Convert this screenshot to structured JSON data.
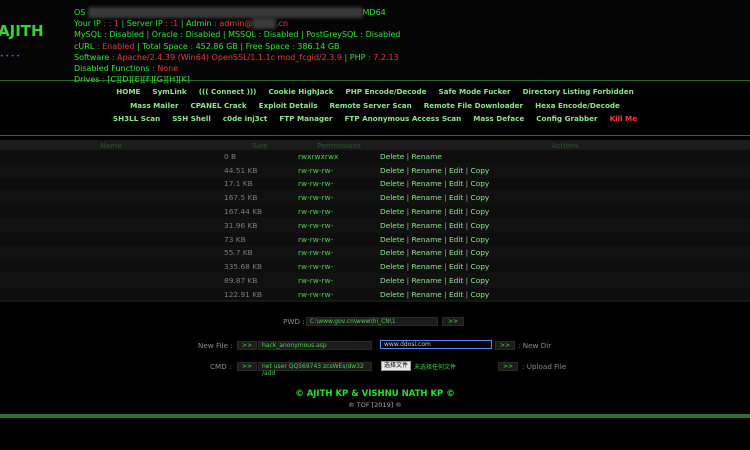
{
  "logo": {
    "text": "AJITH",
    "sub": "• • • •"
  },
  "info": {
    "os_label": "OS",
    "os_tail": "MD64",
    "user_label": "Your IP",
    "user_val": ": : 1",
    "server_label": "Server IP",
    "server_val": ": :1",
    "admin_label": "Admin",
    "admin_val": "admin@",
    "admin_tail": ".cn",
    "mysql_line": "MySQL : Disabled | Oracle : Disabled | MSSQL : Disabled | PostGreySQL : Disabled",
    "curl_label": "cURL",
    "curl_val": "Enabled",
    "total_label": "Total Space",
    "total_val": "452.86 GB",
    "free_label": "Free Space",
    "free_val": "386.14 GB",
    "software_label": "Software",
    "software_val": "Apache/2.4.39 (Win64) OpenSSL/1.1.1c mod_fcgid/2.3.9",
    "php_label": "PHP",
    "php_val": "7.2.13",
    "disabled_label": "Disabled Functions",
    "disabled_val": "None",
    "drives_label": "Drives",
    "drives_val": "[C][D][E][F][G][H][K]"
  },
  "nav": [
    [
      "HOME",
      "SymLink",
      "((( Connect )))",
      "Cookie HighJack",
      "PHP Encode/Decode",
      "Safe Mode Fucker",
      "Directory Listing Forbidden"
    ],
    [
      "Mass Mailer",
      "CPANEL Crack",
      "Exploit Details",
      "Remote Server Scan",
      "Remote File Downloader",
      "Hexa Encode/Decode"
    ],
    [
      "SH3LL Scan",
      "SSH Shell",
      "c0de inj3ct",
      "FTP Manager",
      "FTP Anonymous Access Scan",
      "Mass Deface",
      "Config Grabber",
      "Kill Me"
    ]
  ],
  "table": {
    "headers": {
      "name": "Name",
      "size": "Size",
      "perm": "Permissions",
      "actions": "Actions"
    },
    "rows": [
      {
        "size": "0 B",
        "perm": "rwxrwxrwx",
        "type": "dir"
      },
      {
        "size": "44.51 KB",
        "perm": "rw-rw-rw-",
        "type": "file"
      },
      {
        "size": "17.1 KB",
        "perm": "rw-rw-rw-",
        "type": "file"
      },
      {
        "size": "167.5 KB",
        "perm": "rw-rw-rw-",
        "type": "file"
      },
      {
        "size": "167.44 KB",
        "perm": "rw-rw-rw-",
        "type": "file"
      },
      {
        "size": "31.96 KB",
        "perm": "rw-rw-rw-",
        "type": "file"
      },
      {
        "size": "73 KB",
        "perm": "rw-rw-rw-",
        "type": "file"
      },
      {
        "size": "55.7 KB",
        "perm": "rw-rw-rw-",
        "type": "file"
      },
      {
        "size": "335.68 KB",
        "perm": "rw-rw-rw-",
        "type": "file"
      },
      {
        "size": "89.87 KB",
        "perm": "rw-rw-rw-",
        "type": "file"
      },
      {
        "size": "122.91 KB",
        "perm": "rw-rw-rw-",
        "type": "file"
      }
    ],
    "actions": {
      "delete": "Delete",
      "rename": "Rename",
      "edit": "Edit",
      "copy": "Copy"
    }
  },
  "forms": {
    "pwd_label": "PWD :",
    "pwd_value": "C:\\www.gov.cn\\www\\hi_CN\\1",
    "go": ">>",
    "newfile_label": "New File :",
    "newfile_value": "hack_anonymous.asp",
    "newdir_value": "www.ddosi.com",
    "newdir_label": ": New Dir",
    "cmd_label": "CMD :",
    "cmd_value": "net user QQ569743 zcsWEs/dw32 /add",
    "choose_file": "选择文件",
    "no_file": "未选择任何文件",
    "upload_label": ": Upload File"
  },
  "footer": {
    "copyright": "© AJITH KP & VISHNU NATH KP ©",
    "tof": "® TOF [2019] ®"
  }
}
